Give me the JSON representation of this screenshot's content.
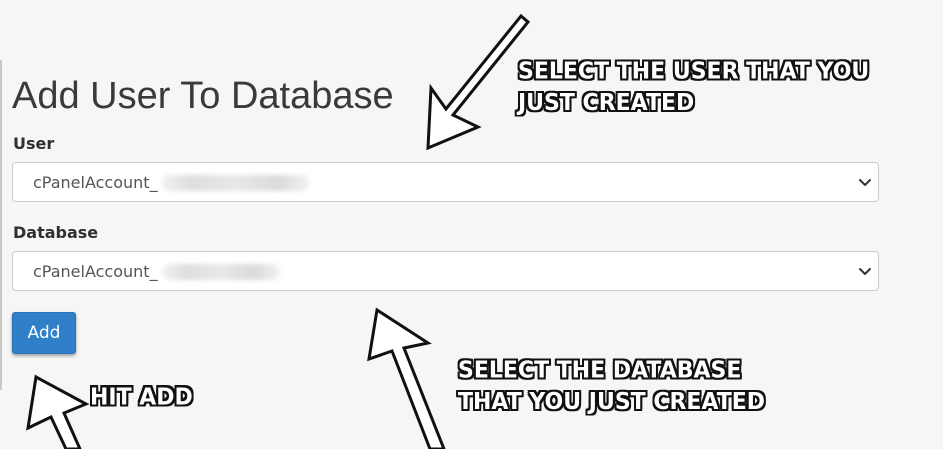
{
  "form": {
    "title": "Add User To Database",
    "user_label": "User",
    "user_selected_prefix": "cPanelAccount_",
    "database_label": "Database",
    "database_selected_prefix": "cPanelAccount_",
    "add_button_label": "Add"
  },
  "annotations": {
    "user_line1": "SELECT THE USER THAT YOU",
    "user_line2": "JUST CREATED",
    "database_line1": "SELECT THE DATABASE",
    "database_line2": "THAT YOU JUST CREATED",
    "add": "HIT ADD"
  },
  "icons": {
    "select_caret": "chevron-down-icon",
    "callout_arrow": "arrow-icon"
  },
  "colors": {
    "background": "#f6f6f6",
    "primary_button": "#2f7fc9",
    "annotation_text": "#ffffff",
    "annotation_outline": "#111111"
  }
}
